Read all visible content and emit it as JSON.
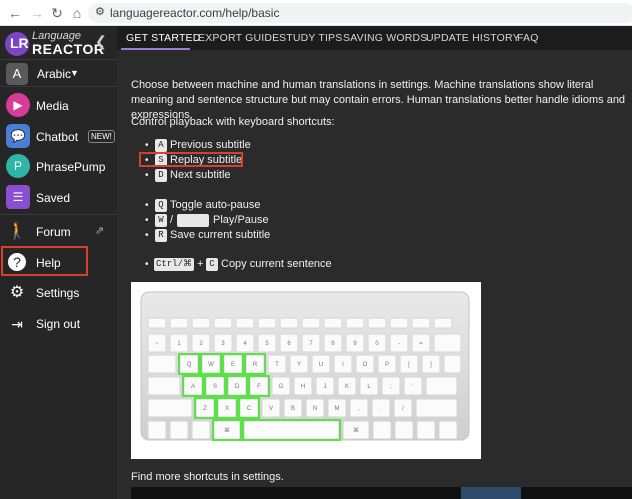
{
  "browser": {
    "url": "languagereactor.com/help/basic",
    "back_icon": "arrow-left-icon",
    "forward_icon": "arrow-right-icon",
    "reload_icon": "reload-icon",
    "home_icon": "home-icon",
    "url_icon": "site-settings-icon"
  },
  "sidebar": {
    "logo_line1": "Language",
    "logo_line2": "REACTOR",
    "language_badge": "A",
    "language_label": "Arabic",
    "items": [
      {
        "label": "Media",
        "icon": "play-icon",
        "color": "#d83b9a"
      },
      {
        "label": "Chatbot",
        "icon": "chat-icon",
        "color": "#4a7fd6",
        "badge": "NEW!"
      },
      {
        "label": "PhrasePump",
        "icon": "phrasepump-icon",
        "color": "#2fb5a6"
      },
      {
        "label": "Saved",
        "icon": "list-icon",
        "color": "#8a4fd0"
      },
      {
        "label": "Forum",
        "icon": "forum-icon"
      },
      {
        "label": "Help",
        "icon": "help-icon"
      },
      {
        "label": "Settings",
        "icon": "gear-icon"
      },
      {
        "label": "Sign out",
        "icon": "sign-out-icon"
      }
    ]
  },
  "tabs": [
    "GET STARTED",
    "EXPORT GUIDE",
    "STUDY TIPS",
    "SAVING WORDS",
    "UPDATE HISTORY",
    "FAQ"
  ],
  "content": {
    "intro": "Choose between machine and human translations in settings. Machine translations show literal meaning and sentence structure but may contain errors. Human translations better handle idioms and expressions.",
    "kb_heading": "Control playback with keyboard shortcuts:",
    "shortcuts": [
      {
        "key": "A",
        "label": "Previous subtitle"
      },
      {
        "key": "S",
        "label": "Replay subtitle"
      },
      {
        "key": "D",
        "label": "Next subtitle"
      },
      {
        "key": "Q",
        "label": "Toggle auto-pause"
      },
      {
        "key": "W",
        "label": "Play/Pause"
      },
      {
        "key": "R",
        "label": "Save current subtitle"
      }
    ],
    "slash": "/",
    "ctrl_key": "Ctrl/⌘",
    "plus": "+",
    "copy_key": "C",
    "copy_label": "Copy current sentence",
    "find_more": "Find more shortcuts in settings."
  },
  "colors": {
    "highlight": "#d9402b",
    "accent": "#9e7bdb",
    "key_highlight": "#5ee04a"
  },
  "keyboard_highlight_keys": [
    "Q",
    "W",
    "E",
    "R",
    "A",
    "S",
    "D",
    "F",
    "C",
    "Z",
    "X",
    "space",
    "command"
  ]
}
